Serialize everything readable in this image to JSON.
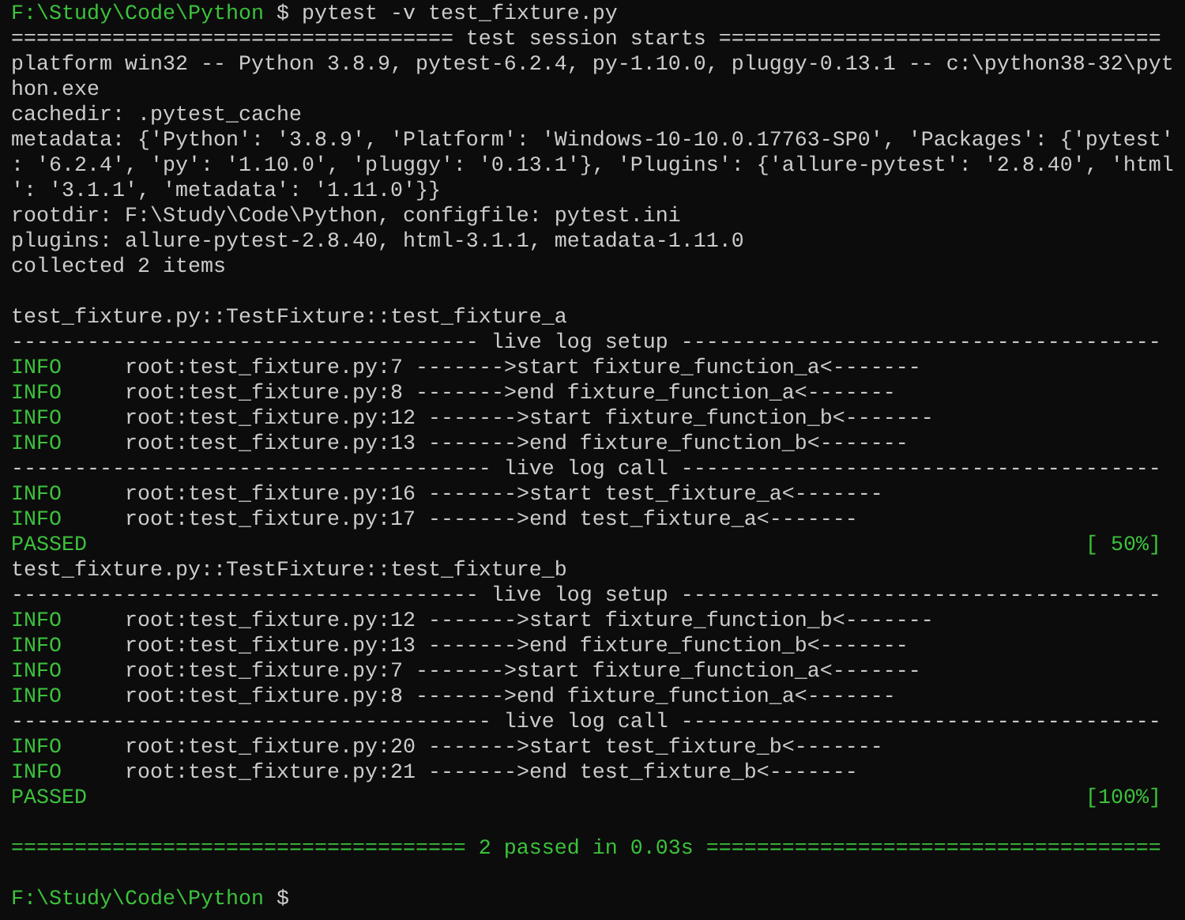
{
  "terminal": {
    "lines": [
      {
        "kind": "prompt",
        "path": "F:\\Study\\Code\\Python",
        "symbol": "$",
        "command": "pytest -v test_fixture.py"
      },
      {
        "kind": "rule",
        "text": "=================================== test session starts ==================================="
      },
      {
        "kind": "text",
        "text": "platform win32 -- Python 3.8.9, pytest-6.2.4, py-1.10.0, pluggy-0.13.1 -- c:\\python38-32\\pyt"
      },
      {
        "kind": "text",
        "text": "hon.exe"
      },
      {
        "kind": "text",
        "text": "cachedir: .pytest_cache"
      },
      {
        "kind": "text",
        "text": "metadata: {'Python': '3.8.9', 'Platform': 'Windows-10-10.0.17763-SP0', 'Packages': {'pytest'"
      },
      {
        "kind": "text",
        "text": ": '6.2.4', 'py': '1.10.0', 'pluggy': '0.13.1'}, 'Plugins': {'allure-pytest': '2.8.40', 'html"
      },
      {
        "kind": "text",
        "text": "': '3.1.1', 'metadata': '1.11.0'}}"
      },
      {
        "kind": "text",
        "text": "rootdir: F:\\Study\\Code\\Python, configfile: pytest.ini"
      },
      {
        "kind": "text",
        "text": "plugins: allure-pytest-2.8.40, html-3.1.1, metadata-1.11.0"
      },
      {
        "kind": "text",
        "text": "collected 2 items"
      },
      {
        "kind": "blank"
      },
      {
        "kind": "text",
        "text": "test_fixture.py::TestFixture::test_fixture_a"
      },
      {
        "kind": "rule",
        "text": "------------------------------------- live log setup --------------------------------------"
      },
      {
        "kind": "log",
        "level": "INFO",
        "message": "root:test_fixture.py:7 ------->start fixture_function_a<-------"
      },
      {
        "kind": "log",
        "level": "INFO",
        "message": "root:test_fixture.py:8 ------->end fixture_function_a<-------"
      },
      {
        "kind": "log",
        "level": "INFO",
        "message": "root:test_fixture.py:12 ------->start fixture_function_b<-------"
      },
      {
        "kind": "log",
        "level": "INFO",
        "message": "root:test_fixture.py:13 ------->end fixture_function_b<-------"
      },
      {
        "kind": "rule",
        "text": "-------------------------------------- live log call --------------------------------------"
      },
      {
        "kind": "log",
        "level": "INFO",
        "message": "root:test_fixture.py:16 ------->start test_fixture_a<-------"
      },
      {
        "kind": "log",
        "level": "INFO",
        "message": "root:test_fixture.py:17 ------->end test_fixture_a<-------"
      },
      {
        "kind": "result",
        "status": "PASSED",
        "progress": "[ 50%]"
      },
      {
        "kind": "text",
        "text": "test_fixture.py::TestFixture::test_fixture_b"
      },
      {
        "kind": "rule",
        "text": "------------------------------------- live log setup --------------------------------------"
      },
      {
        "kind": "log",
        "level": "INFO",
        "message": "root:test_fixture.py:12 ------->start fixture_function_b<-------"
      },
      {
        "kind": "log",
        "level": "INFO",
        "message": "root:test_fixture.py:13 ------->end fixture_function_b<-------"
      },
      {
        "kind": "log",
        "level": "INFO",
        "message": "root:test_fixture.py:7 ------->start fixture_function_a<-------"
      },
      {
        "kind": "log",
        "level": "INFO",
        "message": "root:test_fixture.py:8 ------->end fixture_function_a<-------"
      },
      {
        "kind": "rule",
        "text": "-------------------------------------- live log call --------------------------------------"
      },
      {
        "kind": "log",
        "level": "INFO",
        "message": "root:test_fixture.py:20 ------->start test_fixture_b<-------"
      },
      {
        "kind": "log",
        "level": "INFO",
        "message": "root:test_fixture.py:21 ------->end test_fixture_b<-------"
      },
      {
        "kind": "result",
        "status": "PASSED",
        "progress": "[100%]"
      },
      {
        "kind": "blank"
      },
      {
        "kind": "summary",
        "text": "==================================== 2 passed in 0.03s ===================================="
      },
      {
        "kind": "blank"
      },
      {
        "kind": "prompt",
        "path": "F:\\Study\\Code\\Python",
        "symbol": "$"
      }
    ]
  }
}
